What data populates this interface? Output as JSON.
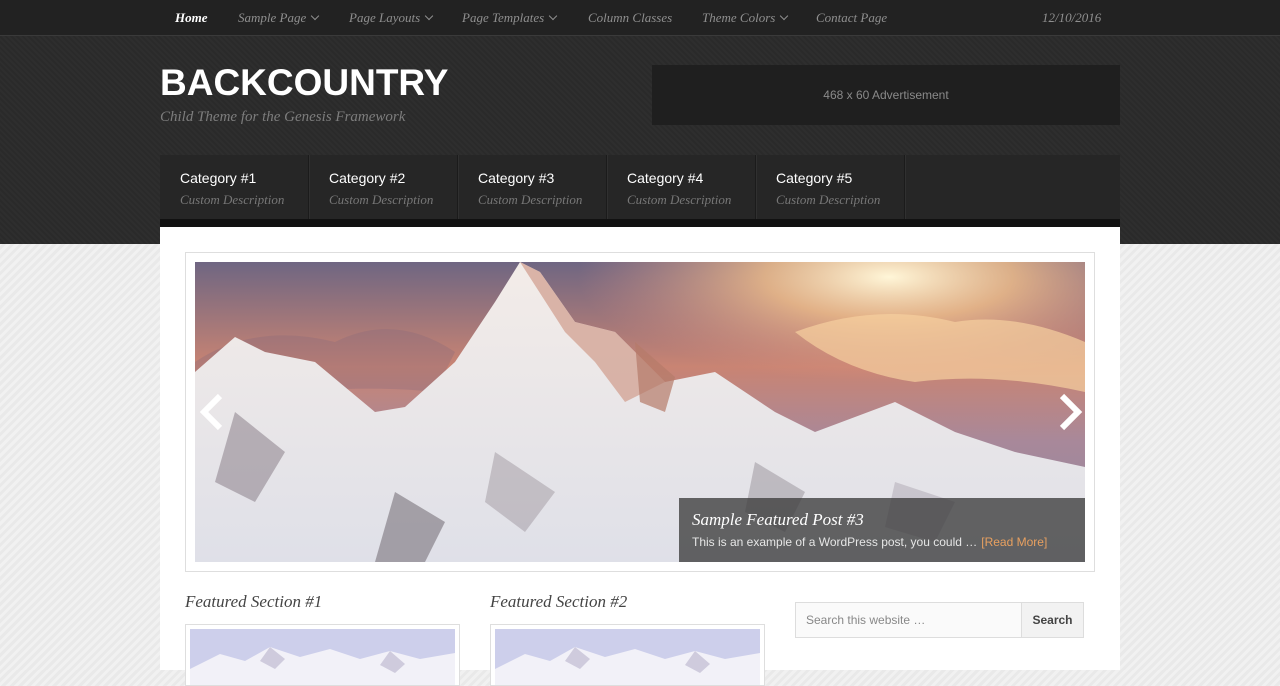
{
  "topnav": {
    "items": [
      {
        "label": "Home",
        "active": true,
        "dropdown": false
      },
      {
        "label": "Sample Page",
        "active": false,
        "dropdown": true
      },
      {
        "label": "Page Layouts",
        "active": false,
        "dropdown": true
      },
      {
        "label": "Page Templates",
        "active": false,
        "dropdown": true
      },
      {
        "label": "Column Classes",
        "active": false,
        "dropdown": false
      },
      {
        "label": "Theme Colors",
        "active": false,
        "dropdown": true
      },
      {
        "label": "Contact Page",
        "active": false,
        "dropdown": false
      }
    ],
    "date": "12/10/2016"
  },
  "header": {
    "title": "BACKCOUNTRY",
    "description": "Child Theme for the Genesis Framework",
    "ad_text": "468 x 60 Advertisement"
  },
  "catnav": {
    "items": [
      {
        "name": "Category #1",
        "desc": "Custom Description"
      },
      {
        "name": "Category #2",
        "desc": "Custom Description"
      },
      {
        "name": "Category #3",
        "desc": "Custom Description"
      },
      {
        "name": "Category #4",
        "desc": "Custom Description"
      },
      {
        "name": "Category #5",
        "desc": "Custom Description"
      }
    ]
  },
  "slider": {
    "caption_title": "Sample Featured Post #3",
    "caption_text": "This is an example of a WordPress post, you could …",
    "read_more": "[Read More]",
    "prev_icon": "chevron-left-icon",
    "next_icon": "chevron-right-icon"
  },
  "featured": {
    "sections": [
      {
        "title": "Featured Section #1"
      },
      {
        "title": "Featured Section #2"
      }
    ]
  },
  "search": {
    "placeholder": "Search this website …",
    "button_label": "Search"
  },
  "colors": {
    "header_bg": "#2b2b2b",
    "nav_bg": "#222222",
    "read_more": "#e8a060"
  }
}
